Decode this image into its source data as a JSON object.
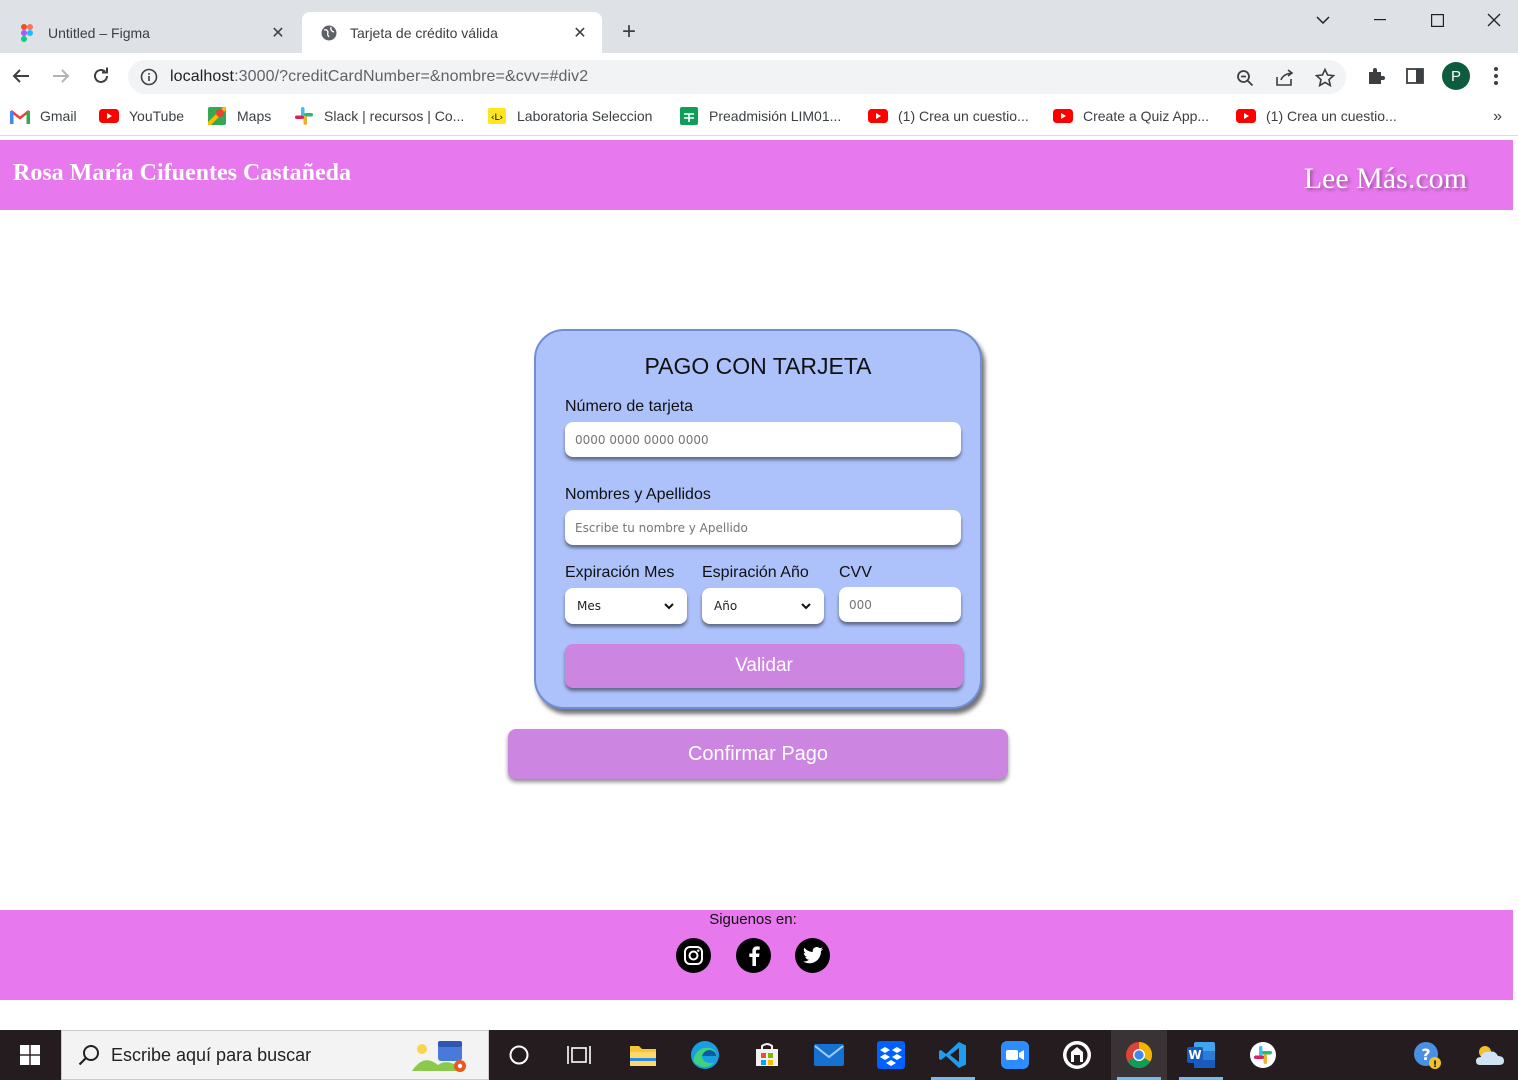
{
  "browser": {
    "tabs": [
      {
        "title": "Untitled – Figma",
        "active": false,
        "icon": "figma-icon"
      },
      {
        "title": "Tarjeta de crédito válida",
        "active": true,
        "icon": "globe-icon"
      }
    ],
    "url_host": "localhost",
    "url_rest": ":3000/?creditCardNumber=&nombre=&cvv=#div2",
    "profile_initial": "P",
    "bookmarks": [
      {
        "label": "Gmail",
        "icon": "gmail-icon"
      },
      {
        "label": "YouTube",
        "icon": "youtube-icon"
      },
      {
        "label": "Maps",
        "icon": "maps-icon"
      },
      {
        "label": "Slack | recursos | Co...",
        "icon": "slack-icon"
      },
      {
        "label": "Laboratoria Seleccion",
        "icon": "laboratoria-icon"
      },
      {
        "label": "Preadmisión LIM01...",
        "icon": "sheets-icon"
      },
      {
        "label": "(1) Crea un cuestio...",
        "icon": "youtube-icon"
      },
      {
        "label": "Create a Quiz App...",
        "icon": "youtube-icon"
      },
      {
        "label": "(1) Crea un cuestio...",
        "icon": "youtube-icon"
      }
    ],
    "bookmarks_more": "»"
  },
  "header": {
    "author": "Rosa María Cifuentes Castañeda",
    "brand": "Lee Más.com"
  },
  "card": {
    "title": "PAGO CON TARJETA",
    "card_number_label": "Número de tarjeta",
    "card_number_placeholder": "0000 0000 0000 0000",
    "name_label": "Nombres y Apellidos",
    "name_placeholder": "Escribe tu nombre y Apellido",
    "exp_month_label": "Expiración Mes",
    "exp_month_value": "Mes",
    "exp_year_label": "Espiración Año",
    "exp_year_value": "Año",
    "cvv_label": "CVV",
    "cvv_placeholder": "000",
    "validate_label": "Validar"
  },
  "confirm_label": "Confirmar Pago",
  "footer": {
    "follow_text": "Siguenos en:",
    "socials": [
      "instagram-icon",
      "facebook-icon",
      "twitter-icon"
    ]
  },
  "taskbar": {
    "search_placeholder": "Escribe aquí para buscar",
    "apps": [
      "cortana-icon",
      "task-view-icon",
      "file-explorer-icon",
      "edge-icon",
      "store-icon",
      "mail-icon",
      "dropbox-icon",
      "vscode-icon",
      "zoom-icon",
      "github-desktop-icon",
      "chrome-icon",
      "word-icon",
      "slack-icon"
    ]
  },
  "colors": {
    "header_bg": "#e878ee",
    "card_bg": "#adc1fa",
    "button_bg": "#cc85e0"
  }
}
